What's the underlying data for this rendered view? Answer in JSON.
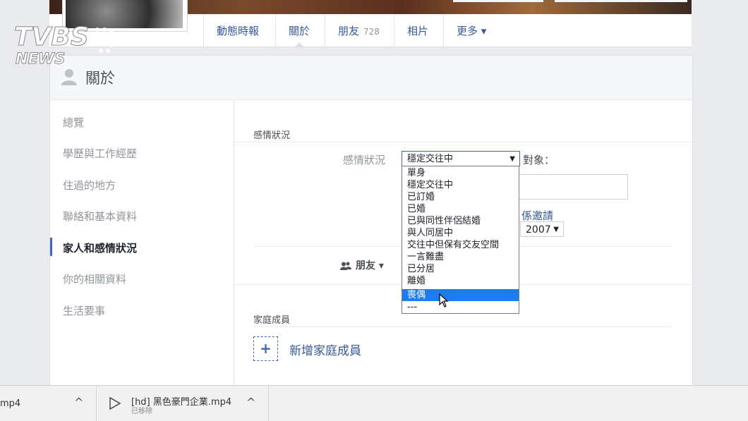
{
  "watermark": {
    "text": "TVBS NEWS"
  },
  "nav": {
    "timeline": "動態時報",
    "about": "關於",
    "friends": "朋友",
    "friends_count": "728",
    "photos": "相片",
    "more": "更多 ▾"
  },
  "about": {
    "title": "關於"
  },
  "sidebar": {
    "items": [
      {
        "label": "總覽"
      },
      {
        "label": "學歷與工作經歷"
      },
      {
        "label": "住過的地方"
      },
      {
        "label": "聯絡和基本資料"
      },
      {
        "label": "家人和感情狀況"
      },
      {
        "label": "你的相關資料"
      },
      {
        "label": "生活要事"
      }
    ],
    "active_index": 4
  },
  "relationship": {
    "section_title": "感情狀況",
    "field_label": "感情狀況",
    "selected": "穩定交往中",
    "with_label": "對象：",
    "invite_text": "係邀請",
    "year": "2007",
    "privacy": "朋友 ▾",
    "options": [
      "單身",
      "穩定交往中",
      "已訂婚",
      "已婚",
      "已與同性伴侶結婚",
      "與人同居中",
      "交往中但保有交友空間",
      "一言難盡",
      "已分居",
      "離婚",
      "喪偶",
      "---"
    ],
    "highlighted_option": "喪偶"
  },
  "family": {
    "section_title": "家庭成員",
    "add_label": "新增家庭成員",
    "add_symbol": "+"
  },
  "downloads": {
    "item1_name": "mp4",
    "item2_name": "[hd] 黑色豪門企業.mp4",
    "item2_status": "已移除",
    "chevron": "^"
  }
}
